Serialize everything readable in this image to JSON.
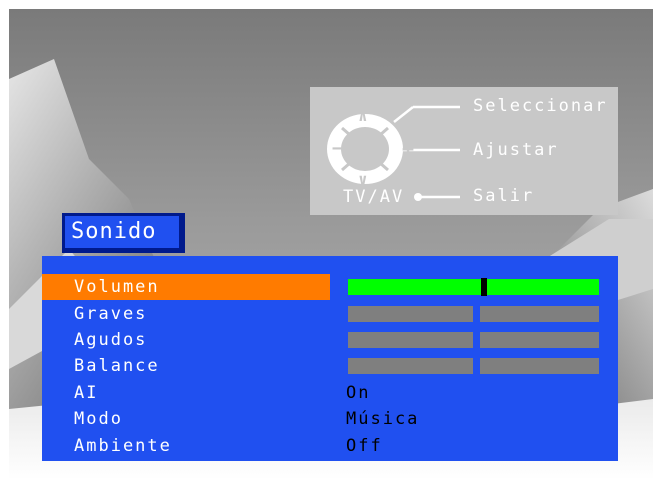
{
  "remote_help": {
    "select_label": "Seleccionar",
    "adjust_label": "Ajustar",
    "exit_label": "Salir",
    "tvav_label": "TV/AV",
    "up_symbol": "∧",
    "down_symbol": "∨",
    "plus_symbol": "+",
    "minus_symbol": "−"
  },
  "menu": {
    "title": "Sonido",
    "items": [
      {
        "label": "Volumen",
        "selected": true,
        "control": "bar",
        "level": 0.54
      },
      {
        "label": "Graves",
        "control": "bar"
      },
      {
        "label": "Agudos",
        "control": "bar"
      },
      {
        "label": "Balance",
        "control": "bar"
      },
      {
        "label": "AI",
        "value": "On"
      },
      {
        "label": "Modo",
        "value": "Música"
      },
      {
        "label": "Ambiente",
        "value": "Off"
      }
    ]
  },
  "colors": {
    "menu_background": "#2050f0",
    "title_shadow": "#001a8c",
    "selected_row": "#ff7b00",
    "volume_bar": "#00ff00",
    "inactive_bar": "#7f7f7f",
    "help_panel": "#c8c8c8"
  }
}
